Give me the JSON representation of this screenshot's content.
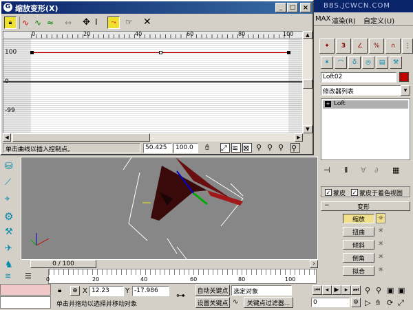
{
  "dialog": {
    "title": "缩放变形(X)",
    "ruler_ticks": [
      "0",
      "20",
      "40",
      "60",
      "80",
      "100"
    ],
    "y_labels": [
      "100",
      "0",
      "-99"
    ],
    "status_text": "单击曲线以插入控制点。",
    "coord_x": "50.425",
    "coord_y": "100.0"
  },
  "watermark": "BBS.JCWCN.COM",
  "menu": {
    "render": "渲染(R)",
    "customize": "自定义(U)",
    "max": "MAX"
  },
  "panel": {
    "object_name": "Loft02",
    "modifier_list": "修改器列表",
    "stack_item": "Loft",
    "skin_label": "蒙皮",
    "skin_shaded_label": "蒙皮于着色视图",
    "rollout_title": "变形",
    "buttons": [
      "缩放",
      "扭曲",
      "倾斜",
      "倒角",
      "拟合"
    ],
    "name_color": "#c00000"
  },
  "timeline": {
    "frame_display": "0 / 100",
    "ticks": [
      "0",
      "20",
      "40",
      "60",
      "80",
      "100"
    ]
  },
  "status": {
    "x_label": "X",
    "x_value": "12.23",
    "y_label": "Y",
    "y_value": "-17.986",
    "auto_key": "自动关键点",
    "set_key": "设置关键点",
    "selected_object": "选定对象",
    "key_filters": "关键点过滤器...",
    "frame_value": "0",
    "prompt": "单击并拖动以选择并移动对象"
  },
  "colors": {
    "title_bar": "#0a246a",
    "viewport_bg": "#878787",
    "curve": "#c00000"
  }
}
